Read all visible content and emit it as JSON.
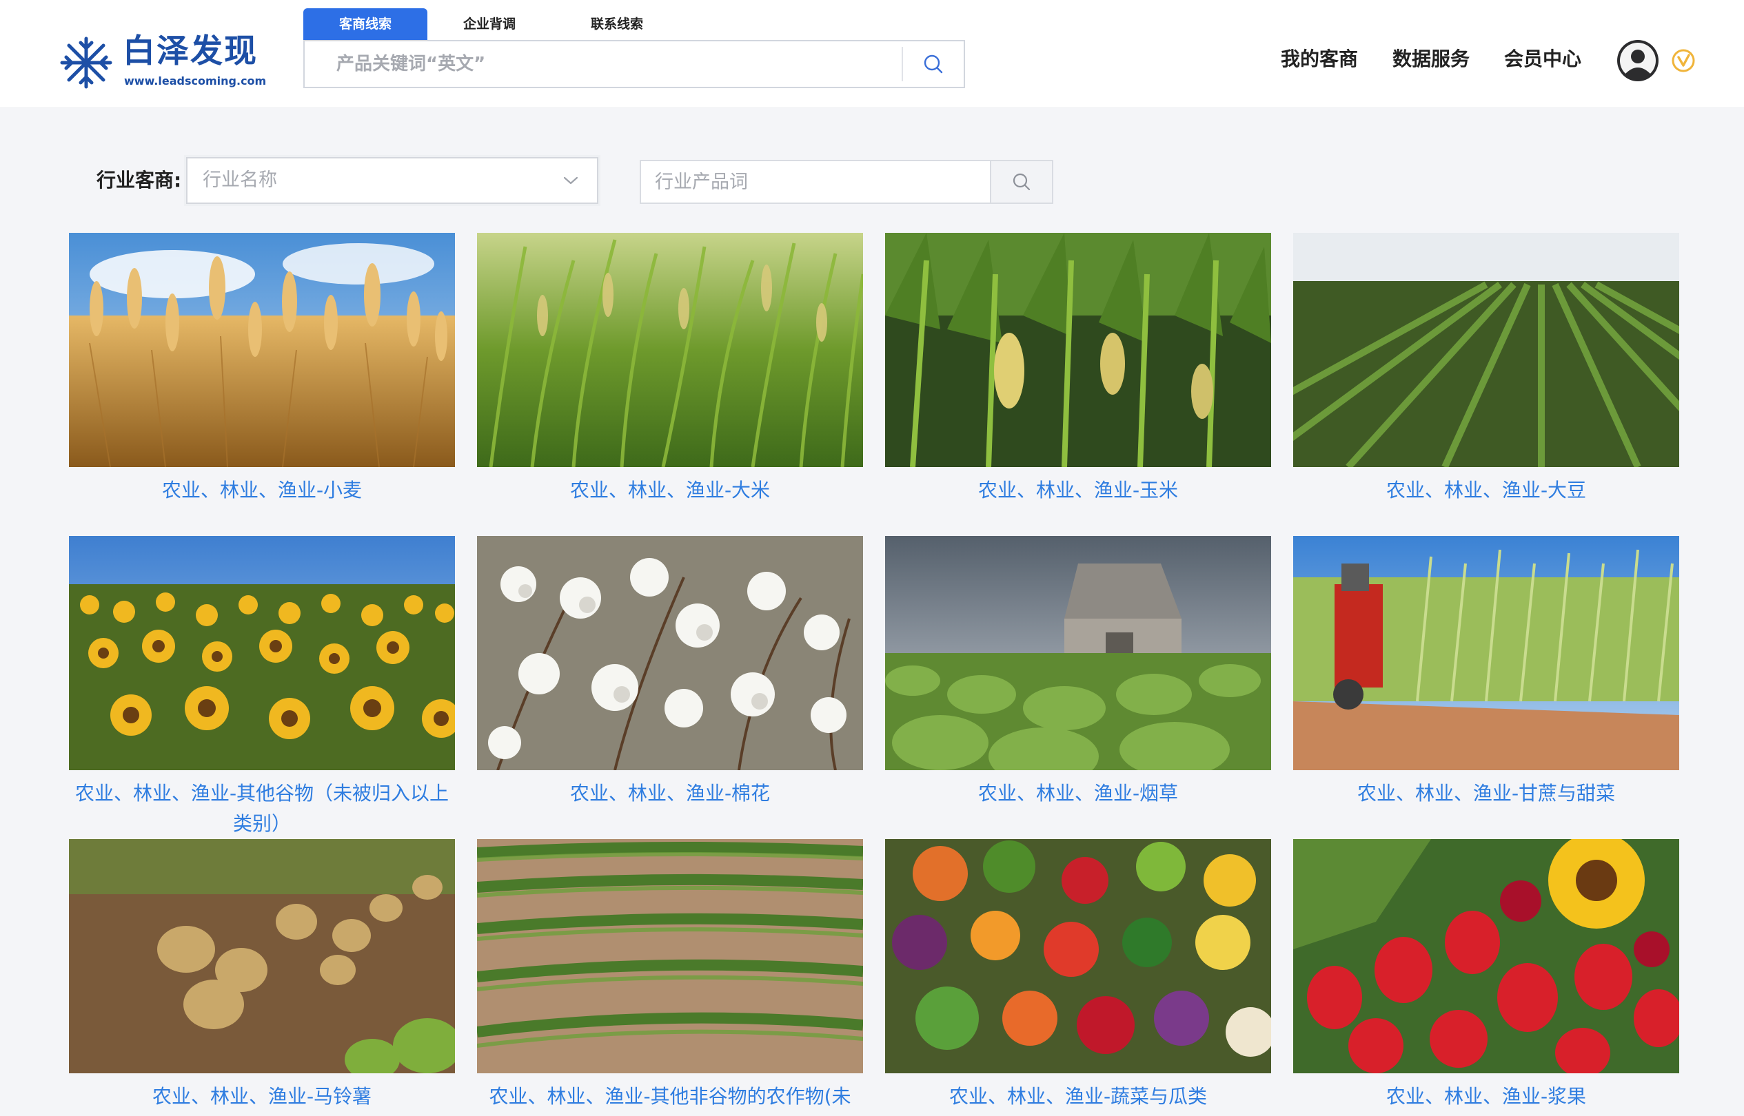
{
  "header": {
    "logo_title": "白泽发现",
    "logo_url": "www.leadscoming.com",
    "search_tabs": [
      "客商线索",
      "企业背调",
      "联系线索"
    ],
    "search_placeholder": "产品关键词“英文”",
    "nav": [
      "我的客商",
      "数据服务",
      "会员中心"
    ]
  },
  "filter": {
    "label": "行业客商:",
    "industry_placeholder": "行业名称",
    "product_placeholder": "行业产品词"
  },
  "cards": [
    {
      "caption": "农业、林业、渔业-小麦",
      "image": "wheat-field"
    },
    {
      "caption": "农业、林业、渔业-大米",
      "image": "rice-plants"
    },
    {
      "caption": "农业、林业、渔业-玉米",
      "image": "corn-field"
    },
    {
      "caption": "农业、林业、渔业-大豆",
      "image": "soybean-rows"
    },
    {
      "caption": "农业、林业、渔业-其他谷物（未被归入以上类别）",
      "image": "sunflower-field"
    },
    {
      "caption": "农业、林业、渔业-棉花",
      "image": "cotton-plants"
    },
    {
      "caption": "农业、林业、渔业-烟草",
      "image": "tobacco-field-barn"
    },
    {
      "caption": "农业、林业、渔业-甘蔗与甜菜",
      "image": "sugarcane-harvester"
    },
    {
      "caption": "农业、林业、渔业-马铃薯",
      "image": "potatoes-soil"
    },
    {
      "caption": "农业、林业、渔业-其他非谷物的农作物(未",
      "image": "crop-rows"
    },
    {
      "caption": "农业、林业、渔业-蔬菜与瓜类",
      "image": "vegetables-pile"
    },
    {
      "caption": "农业、林业、渔业-浆果",
      "image": "strawberries"
    }
  ],
  "colors": {
    "accent": "#2d6fe6",
    "caption": "#2f7de0",
    "logo": "#1d4fa6",
    "vip_badge": "#f0b43a"
  },
  "icons": {
    "logo": "snowflake-logo-icon",
    "search": "search-icon",
    "dropdown": "chevron-down-icon",
    "avatar": "user-avatar-icon",
    "vip": "vip-badge-icon"
  }
}
